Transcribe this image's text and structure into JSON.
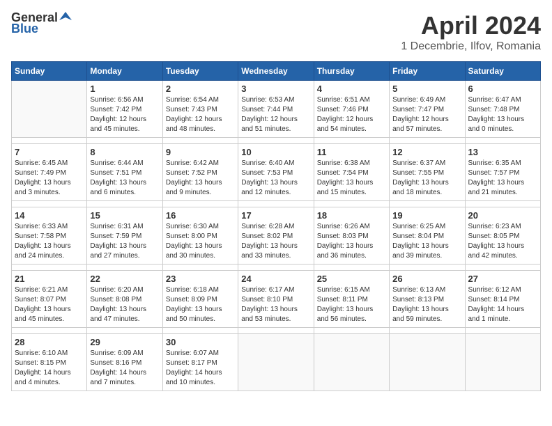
{
  "header": {
    "logo_general": "General",
    "logo_blue": "Blue",
    "title": "April 2024",
    "location": "1 Decembrie, Ilfov, Romania"
  },
  "calendar": {
    "days_of_week": [
      "Sunday",
      "Monday",
      "Tuesday",
      "Wednesday",
      "Thursday",
      "Friday",
      "Saturday"
    ],
    "weeks": [
      [
        {
          "day": "",
          "info": ""
        },
        {
          "day": "1",
          "info": "Sunrise: 6:56 AM\nSunset: 7:42 PM\nDaylight: 12 hours\nand 45 minutes."
        },
        {
          "day": "2",
          "info": "Sunrise: 6:54 AM\nSunset: 7:43 PM\nDaylight: 12 hours\nand 48 minutes."
        },
        {
          "day": "3",
          "info": "Sunrise: 6:53 AM\nSunset: 7:44 PM\nDaylight: 12 hours\nand 51 minutes."
        },
        {
          "day": "4",
          "info": "Sunrise: 6:51 AM\nSunset: 7:46 PM\nDaylight: 12 hours\nand 54 minutes."
        },
        {
          "day": "5",
          "info": "Sunrise: 6:49 AM\nSunset: 7:47 PM\nDaylight: 12 hours\nand 57 minutes."
        },
        {
          "day": "6",
          "info": "Sunrise: 6:47 AM\nSunset: 7:48 PM\nDaylight: 13 hours\nand 0 minutes."
        }
      ],
      [
        {
          "day": "7",
          "info": "Sunrise: 6:45 AM\nSunset: 7:49 PM\nDaylight: 13 hours\nand 3 minutes."
        },
        {
          "day": "8",
          "info": "Sunrise: 6:44 AM\nSunset: 7:51 PM\nDaylight: 13 hours\nand 6 minutes."
        },
        {
          "day": "9",
          "info": "Sunrise: 6:42 AM\nSunset: 7:52 PM\nDaylight: 13 hours\nand 9 minutes."
        },
        {
          "day": "10",
          "info": "Sunrise: 6:40 AM\nSunset: 7:53 PM\nDaylight: 13 hours\nand 12 minutes."
        },
        {
          "day": "11",
          "info": "Sunrise: 6:38 AM\nSunset: 7:54 PM\nDaylight: 13 hours\nand 15 minutes."
        },
        {
          "day": "12",
          "info": "Sunrise: 6:37 AM\nSunset: 7:55 PM\nDaylight: 13 hours\nand 18 minutes."
        },
        {
          "day": "13",
          "info": "Sunrise: 6:35 AM\nSunset: 7:57 PM\nDaylight: 13 hours\nand 21 minutes."
        }
      ],
      [
        {
          "day": "14",
          "info": "Sunrise: 6:33 AM\nSunset: 7:58 PM\nDaylight: 13 hours\nand 24 minutes."
        },
        {
          "day": "15",
          "info": "Sunrise: 6:31 AM\nSunset: 7:59 PM\nDaylight: 13 hours\nand 27 minutes."
        },
        {
          "day": "16",
          "info": "Sunrise: 6:30 AM\nSunset: 8:00 PM\nDaylight: 13 hours\nand 30 minutes."
        },
        {
          "day": "17",
          "info": "Sunrise: 6:28 AM\nSunset: 8:02 PM\nDaylight: 13 hours\nand 33 minutes."
        },
        {
          "day": "18",
          "info": "Sunrise: 6:26 AM\nSunset: 8:03 PM\nDaylight: 13 hours\nand 36 minutes."
        },
        {
          "day": "19",
          "info": "Sunrise: 6:25 AM\nSunset: 8:04 PM\nDaylight: 13 hours\nand 39 minutes."
        },
        {
          "day": "20",
          "info": "Sunrise: 6:23 AM\nSunset: 8:05 PM\nDaylight: 13 hours\nand 42 minutes."
        }
      ],
      [
        {
          "day": "21",
          "info": "Sunrise: 6:21 AM\nSunset: 8:07 PM\nDaylight: 13 hours\nand 45 minutes."
        },
        {
          "day": "22",
          "info": "Sunrise: 6:20 AM\nSunset: 8:08 PM\nDaylight: 13 hours\nand 47 minutes."
        },
        {
          "day": "23",
          "info": "Sunrise: 6:18 AM\nSunset: 8:09 PM\nDaylight: 13 hours\nand 50 minutes."
        },
        {
          "day": "24",
          "info": "Sunrise: 6:17 AM\nSunset: 8:10 PM\nDaylight: 13 hours\nand 53 minutes."
        },
        {
          "day": "25",
          "info": "Sunrise: 6:15 AM\nSunset: 8:11 PM\nDaylight: 13 hours\nand 56 minutes."
        },
        {
          "day": "26",
          "info": "Sunrise: 6:13 AM\nSunset: 8:13 PM\nDaylight: 13 hours\nand 59 minutes."
        },
        {
          "day": "27",
          "info": "Sunrise: 6:12 AM\nSunset: 8:14 PM\nDaylight: 14 hours\nand 1 minute."
        }
      ],
      [
        {
          "day": "28",
          "info": "Sunrise: 6:10 AM\nSunset: 8:15 PM\nDaylight: 14 hours\nand 4 minutes."
        },
        {
          "day": "29",
          "info": "Sunrise: 6:09 AM\nSunset: 8:16 PM\nDaylight: 14 hours\nand 7 minutes."
        },
        {
          "day": "30",
          "info": "Sunrise: 6:07 AM\nSunset: 8:17 PM\nDaylight: 14 hours\nand 10 minutes."
        },
        {
          "day": "",
          "info": ""
        },
        {
          "day": "",
          "info": ""
        },
        {
          "day": "",
          "info": ""
        },
        {
          "day": "",
          "info": ""
        }
      ]
    ]
  }
}
